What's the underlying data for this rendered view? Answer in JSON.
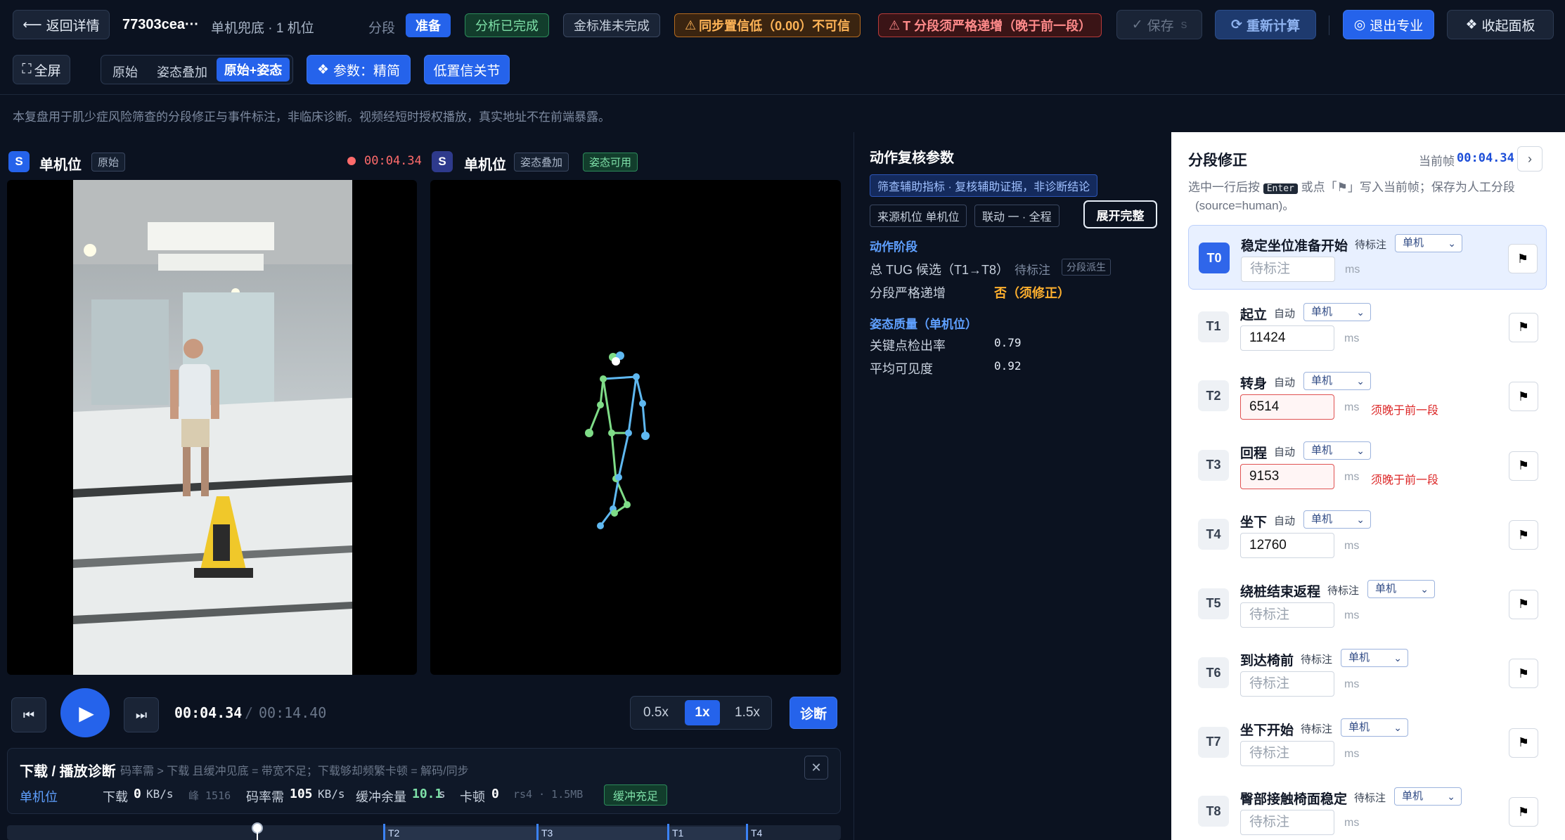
{
  "topbar": {
    "back_label": "返回详情",
    "record_id": "77303cea···",
    "mode_info": "单机兜底 · 1 机位",
    "segment_label": "分段",
    "segment_value": "准备",
    "analysis_status": "分析已完成",
    "gold_status": "金标准未完成",
    "sync_warning": "同步置信低（0.00）不可信",
    "order_warning": "T 分段须严格递增（晚于前一段）",
    "save_label": "保存",
    "save_shortcut": "S",
    "recalc_label": "重新计算",
    "exit_pro_label": "退出专业",
    "collapse_label": "收起面板"
  },
  "toolbar": {
    "fullscreen_label": "全屏",
    "view_modes": [
      "原始",
      "姿态叠加",
      "原始+姿态"
    ],
    "active_view": "原始+姿态",
    "params_label": "参数：精简",
    "low_conf_label": "低置信关节"
  },
  "disclaimer": "本复盘用于肌少症风险筛查的分段修正与事件标注，非临床诊断。视频经短时授权播放，真实地址不在前端暴露。",
  "video_left": {
    "badge": "S",
    "title": "单机位",
    "tag": "原始",
    "time": "00:04.34"
  },
  "video_right": {
    "badge": "S",
    "title": "单机位",
    "tag": "姿态叠加",
    "tag2": "姿态可用"
  },
  "player": {
    "current_time": "00:04.34",
    "separator": "/",
    "total_time": "00:14.40",
    "speeds": [
      "0.5x",
      "1x",
      "1.5x"
    ],
    "active_speed": "1x",
    "diagnose_label": "诊断"
  },
  "diagnostics": {
    "title": "下载 / 播放诊断",
    "hint": "码率需 > 下载 且缓冲见底 = 带宽不足；下载够却频繁卡顿 = 解码/同步",
    "camera": "单机位",
    "download_label": "下载",
    "download_value": "0",
    "download_unit": "KB/s",
    "peak_label": "峰 1516",
    "bitrate_label": "码率需",
    "bitrate_value": "105",
    "bitrate_unit": "KB/s",
    "buffer_label": "缓冲余量",
    "buffer_value": "10.1",
    "buffer_unit": "s",
    "stall_label": "卡顿",
    "stall_value": "0",
    "extra": "rs4 · 1.5MB",
    "buffer_status": "缓冲充足"
  },
  "timeline": {
    "markers": [
      "T2",
      "T3",
      "T1",
      "T4"
    ]
  },
  "review": {
    "title": "动作复核参数",
    "badge": "筛查辅助指标 · 复核辅助证据，非诊断结论",
    "source_chip": "来源机位 单机位",
    "link_chip": "联动 一 · 全程",
    "expand_label": "展开完整",
    "phase_title": "动作阶段",
    "tug_label": "总 TUG 候选（T1→T8）",
    "tug_status": "待标注",
    "tug_tag": "分段派生",
    "strict_label": "分段严格递增",
    "strict_value": "否（须修正）",
    "quality_title": "姿态质量（单机位）",
    "kp_label": "关键点检出率",
    "kp_value": "0.79",
    "vis_label": "平均可见度",
    "vis_value": "0.92"
  },
  "segments": {
    "title": "分段修正",
    "current_frame_label": "当前帧",
    "current_frame": "00:04.34",
    "hint_1": "选中一行后按",
    "hint_key": "Enter",
    "hint_2": "或点「⚑」写入当前帧；保存为人工分段",
    "hint_3": "(source=human)。",
    "unit": "ms",
    "error_text": "须晚于前一段",
    "camera_option": "单机",
    "rows": [
      {
        "id": "T0",
        "name": "稳定坐位准备开始",
        "status": "待标注",
        "value": "",
        "placeholder": "待标注",
        "error": false
      },
      {
        "id": "T1",
        "name": "起立",
        "status": "自动",
        "value": "11424",
        "placeholder": "",
        "error": false
      },
      {
        "id": "T2",
        "name": "转身",
        "status": "自动",
        "value": "6514",
        "placeholder": "",
        "error": true
      },
      {
        "id": "T3",
        "name": "回程",
        "status": "自动",
        "value": "9153",
        "placeholder": "",
        "error": true
      },
      {
        "id": "T4",
        "name": "坐下",
        "status": "自动",
        "value": "12760",
        "placeholder": "",
        "error": false
      },
      {
        "id": "T5",
        "name": "绕桩结束返程",
        "status": "待标注",
        "value": "",
        "placeholder": "待标注",
        "error": false
      },
      {
        "id": "T6",
        "name": "到达椅前",
        "status": "待标注",
        "value": "",
        "placeholder": "待标注",
        "error": false
      },
      {
        "id": "T7",
        "name": "坐下开始",
        "status": "待标注",
        "value": "",
        "placeholder": "待标注",
        "error": false
      },
      {
        "id": "T8",
        "name": "臀部接触椅面稳定",
        "status": "待标注",
        "value": "",
        "placeholder": "待标注",
        "error": false
      }
    ]
  },
  "colors": {
    "accent": "#2563eb",
    "success": "#1f7a4d",
    "warning": "#d98a1a",
    "danger": "#dc2626",
    "pose_green": "#7fdc87",
    "pose_blue": "#5fb8f0"
  }
}
